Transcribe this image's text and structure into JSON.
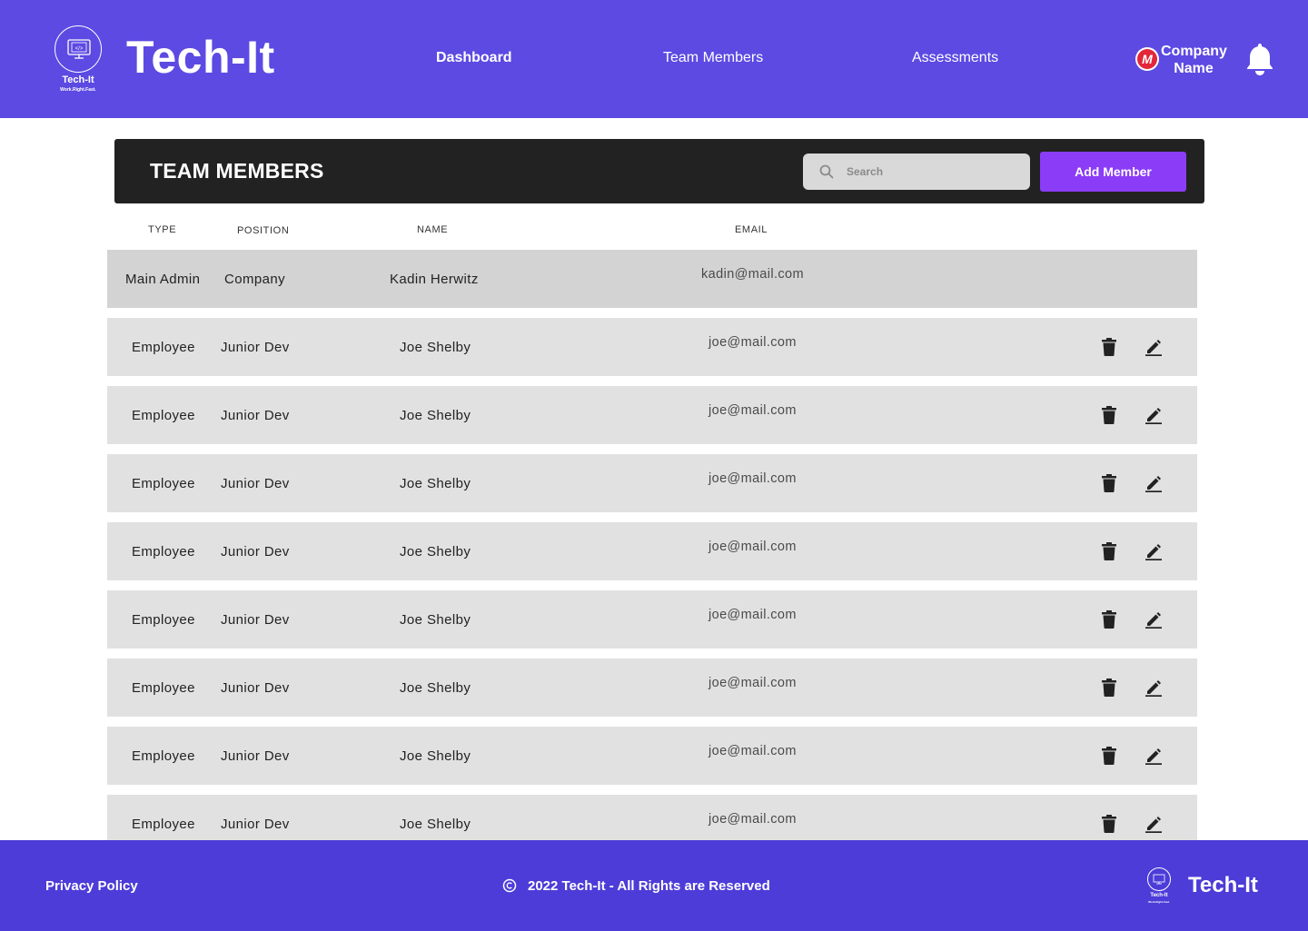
{
  "header": {
    "logo_name": "Tech-It",
    "logo_tagline": "Work.Right.Fast.",
    "brand_title": "Tech-It",
    "nav": [
      {
        "label": "Dashboard",
        "active": true
      },
      {
        "label": "Team Members",
        "active": false
      },
      {
        "label": "Assessments",
        "active": false
      }
    ],
    "company_logo_letter": "M",
    "company_name": "Company Name",
    "bell_icon": "bell-icon"
  },
  "titlebar": {
    "title": "TEAM MEMBERS",
    "search_placeholder": "Search",
    "add_button_label": "Add Member"
  },
  "columns": {
    "type": "TYPE",
    "position": "POSITION",
    "name": "NAME",
    "email": "EMAIL"
  },
  "rows": [
    {
      "type": "Main Admin",
      "position": "Company",
      "name": "Kadin Herwitz",
      "email": "kadin@mail.com"
    },
    {
      "type": "Employee",
      "position": "Junior Dev",
      "name": "Joe Shelby",
      "email": "joe@mail.com"
    },
    {
      "type": "Employee",
      "position": "Junior Dev",
      "name": "Joe Shelby",
      "email": "joe@mail.com"
    },
    {
      "type": "Employee",
      "position": "Junior Dev",
      "name": "Joe Shelby",
      "email": "joe@mail.com"
    },
    {
      "type": "Employee",
      "position": "Junior Dev",
      "name": "Joe Shelby",
      "email": "joe@mail.com"
    },
    {
      "type": "Employee",
      "position": "Junior Dev",
      "name": "Joe Shelby",
      "email": "joe@mail.com"
    },
    {
      "type": "Employee",
      "position": "Junior Dev",
      "name": "Joe Shelby",
      "email": "joe@mail.com"
    },
    {
      "type": "Employee",
      "position": "Junior Dev",
      "name": "Joe Shelby",
      "email": "joe@mail.com"
    },
    {
      "type": "Employee",
      "position": "Junior Dev",
      "name": "Joe Shelby",
      "email": "joe@mail.com"
    }
  ],
  "row_icons": {
    "delete": "trash-icon",
    "edit": "pencil-icon"
  },
  "footer": {
    "privacy": "Privacy Policy",
    "copyright": "2022  Tech-It - All Rights are Reserved",
    "logo_name": "Tech-It",
    "logo_tagline": "Work.Right.Fast.",
    "brand": "Tech-It"
  },
  "colors": {
    "header_bg": "#5c4ae3",
    "footer_bg": "#4d3cd8",
    "accent_button": "#8b3cf7",
    "titlebar_bg": "#222222"
  }
}
